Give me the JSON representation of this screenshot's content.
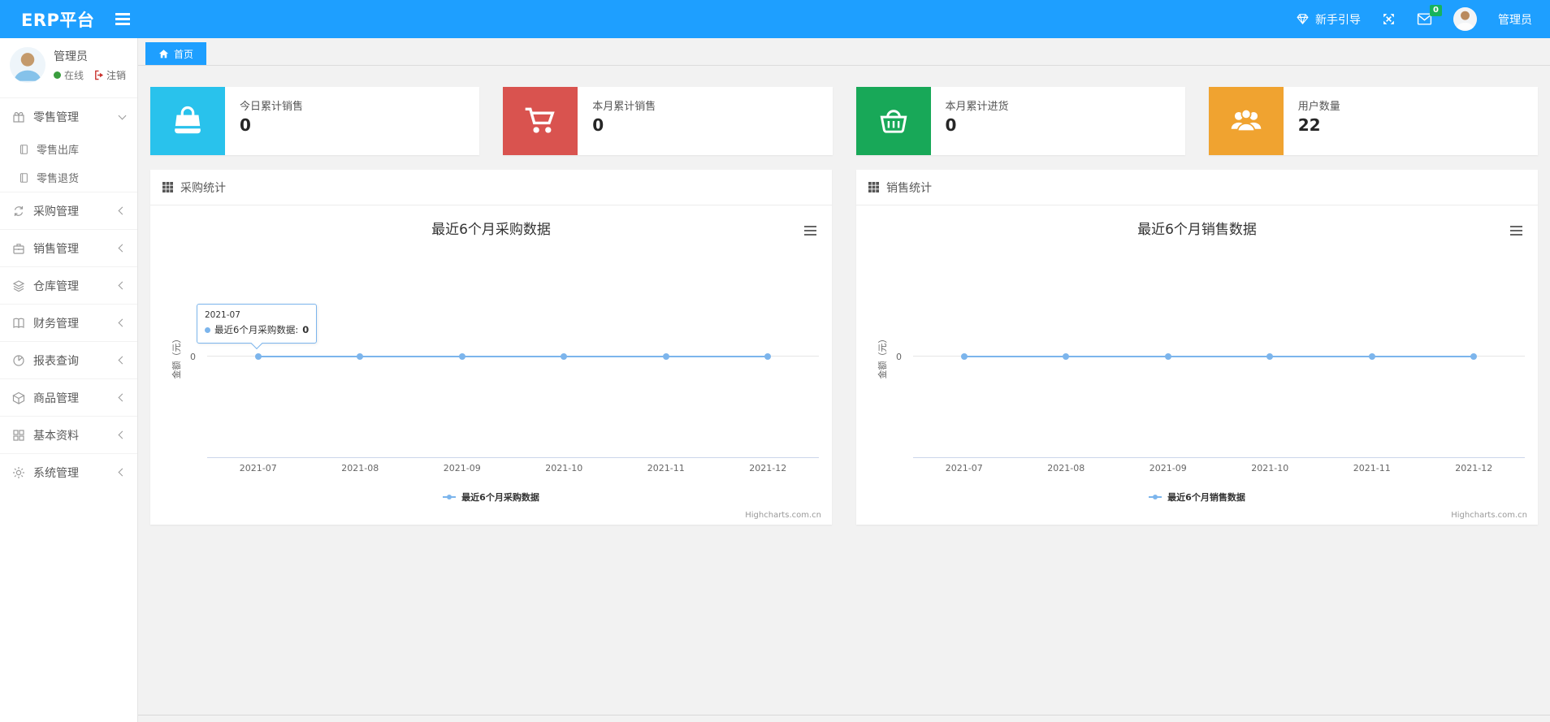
{
  "theme": {
    "navbar_bg": "#1E9FFF",
    "badge_green": "#17b35c",
    "online_green": "#3a9d3e",
    "line_color": "#7cb5ec"
  },
  "navbar": {
    "brand": "ERP平台",
    "guide_label": "新手引导",
    "message_count": "0",
    "username": "管理员"
  },
  "sidebar": {
    "user": {
      "name": "管理员",
      "status_label": "在线",
      "logout_label": "注销"
    },
    "menu": [
      {
        "label": "零售管理",
        "icon": "gift-icon",
        "expanded": true,
        "children": [
          "零售出库",
          "零售退货"
        ]
      },
      {
        "label": "采购管理",
        "icon": "loop-icon"
      },
      {
        "label": "销售管理",
        "icon": "briefcase-icon"
      },
      {
        "label": "仓库管理",
        "icon": "layers-icon"
      },
      {
        "label": "财务管理",
        "icon": "book-icon"
      },
      {
        "label": "报表查询",
        "icon": "pie-chart-icon"
      },
      {
        "label": "商品管理",
        "icon": "cube-icon"
      },
      {
        "label": "基本资料",
        "icon": "grid-icon"
      },
      {
        "label": "系统管理",
        "icon": "gear-icon"
      }
    ]
  },
  "tabs": {
    "home_label": "首页"
  },
  "stats": [
    {
      "label": "今日累计销售",
      "value": "0",
      "color": "#29c2ec",
      "icon": "shopping-bag-icon"
    },
    {
      "label": "本月累计销售",
      "value": "0",
      "color": "#d9534f",
      "icon": "cart-icon"
    },
    {
      "label": "本月累计进货",
      "value": "0",
      "color": "#18a858",
      "icon": "basket-icon"
    },
    {
      "label": "用户数量",
      "value": "22",
      "color": "#f0a330",
      "icon": "users-icon"
    }
  ],
  "panels": [
    {
      "title": "采购统计"
    },
    {
      "title": "销售统计"
    }
  ],
  "chart_data": [
    {
      "type": "line",
      "title": "最近6个月采购数据",
      "categories": [
        "2021-07",
        "2021-08",
        "2021-09",
        "2021-10",
        "2021-11",
        "2021-12"
      ],
      "series": [
        {
          "name": "最近6个月采购数据",
          "values": [
            0,
            0,
            0,
            0,
            0,
            0
          ]
        }
      ],
      "xlabel": "",
      "ylabel": "金额（元）",
      "yticks": [
        "0"
      ],
      "ylim": [
        -1,
        1
      ],
      "line_color": "#7cb5ec",
      "grid": "zero-line-only",
      "legend_position": "bottom",
      "credit": "Highcharts.com.cn",
      "tooltip": {
        "header": "2021-07",
        "series_label": "最近6个月采购数据:",
        "value": "0"
      }
    },
    {
      "type": "line",
      "title": "最近6个月销售数据",
      "categories": [
        "2021-07",
        "2021-08",
        "2021-09",
        "2021-10",
        "2021-11",
        "2021-12"
      ],
      "series": [
        {
          "name": "最近6个月销售数据",
          "values": [
            0,
            0,
            0,
            0,
            0,
            0
          ]
        }
      ],
      "xlabel": "",
      "ylabel": "金额（元）",
      "yticks": [
        "0"
      ],
      "ylim": [
        -1,
        1
      ],
      "line_color": "#7cb5ec",
      "grid": "zero-line-only",
      "legend_position": "bottom",
      "credit": "Highcharts.com.cn"
    }
  ]
}
